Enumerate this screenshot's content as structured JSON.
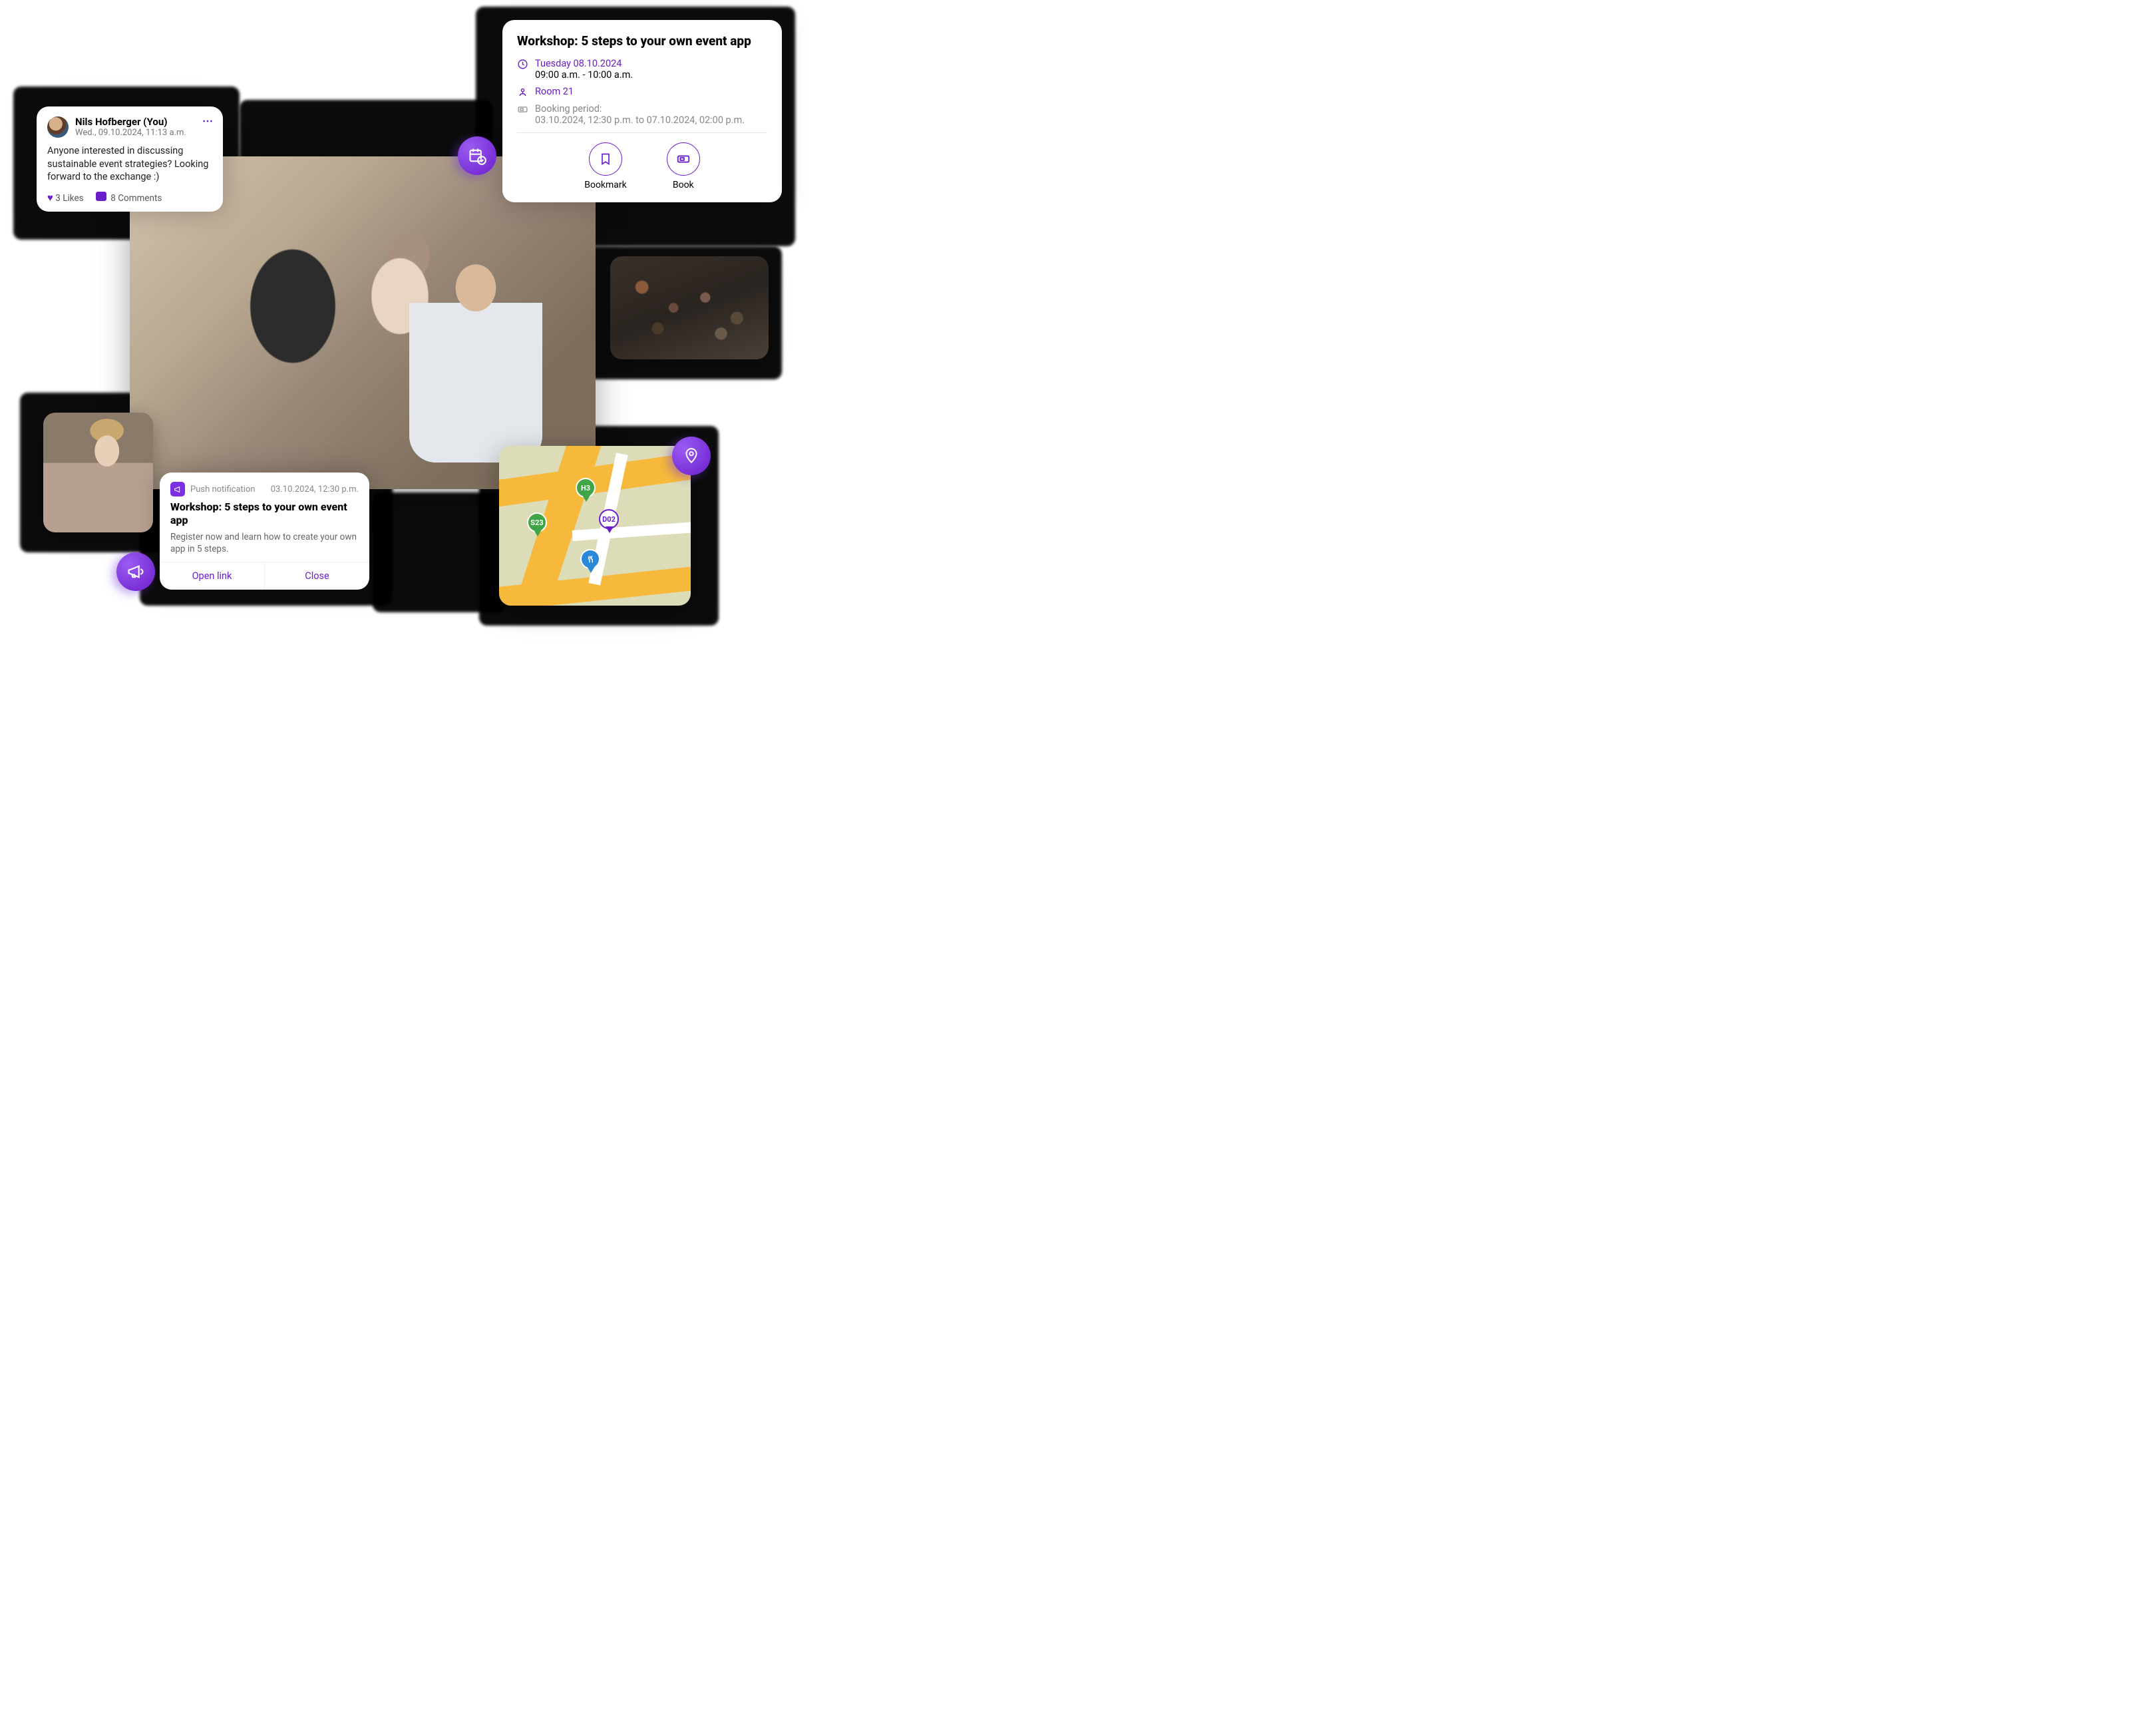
{
  "post": {
    "author": "Nils Hofberger (You)",
    "timestamp": "Wed., 09.10.2024, 11:13 a.m.",
    "body": "Anyone interested in discussing sustainable event strategies? Looking forward to the exchange :)",
    "likes": "3 Likes",
    "comments": "8 Comments"
  },
  "workshop": {
    "title": "Workshop: 5 steps to your own event app",
    "date": "Tuesday 08.10.2024",
    "time": "09:00 a.m. - 10:00 a.m.",
    "room": "Room 21",
    "booking_label": "Booking period:",
    "booking_range": "03.10.2024, 12:30 p.m. to 07.10.2024, 02:00 p.m.",
    "bookmark": "Bookmark",
    "book": "Book"
  },
  "push": {
    "badge": "Push notification",
    "time": "03.10.2024, 12:30 p.m.",
    "title": "Workshop: 5 steps to your own event app",
    "body": "Register now and learn how to create your own app in 5 steps.",
    "open": "Open link",
    "close": "Close"
  },
  "map": {
    "pin_h3": "H3",
    "pin_s23": "S23",
    "pin_d02": "D02"
  }
}
